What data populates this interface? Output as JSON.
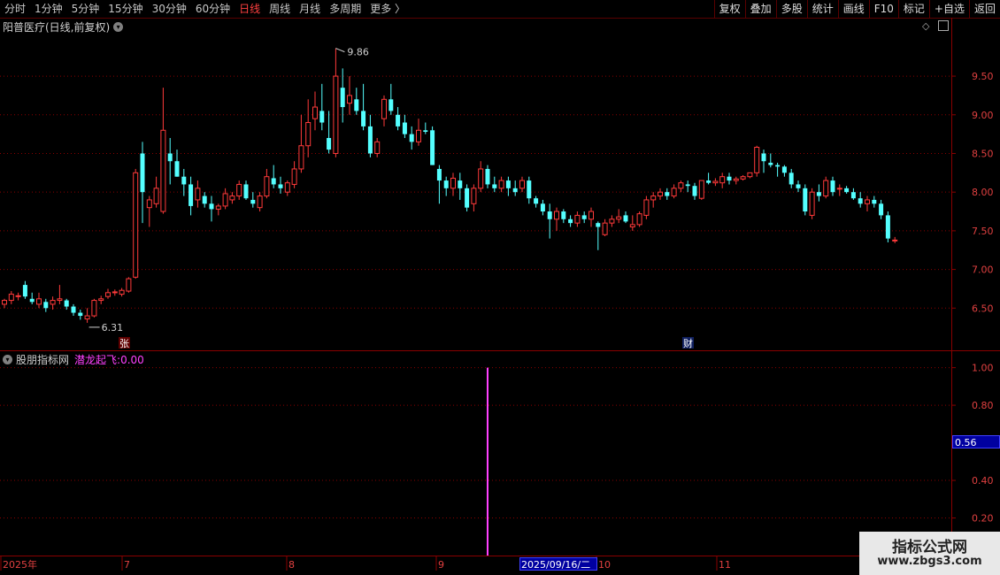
{
  "toolbar": {
    "periods": [
      {
        "label": "分时",
        "active": false
      },
      {
        "label": "1分钟",
        "active": false
      },
      {
        "label": "5分钟",
        "active": false
      },
      {
        "label": "15分钟",
        "active": false
      },
      {
        "label": "30分钟",
        "active": false
      },
      {
        "label": "60分钟",
        "active": false
      },
      {
        "label": "日线",
        "active": true
      },
      {
        "label": "周线",
        "active": false
      },
      {
        "label": "月线",
        "active": false
      },
      {
        "label": "多周期",
        "active": false
      },
      {
        "label": "更多 〉",
        "active": false
      }
    ],
    "actions": [
      "复权",
      "叠加",
      "多股",
      "统计",
      "画线",
      "F10",
      "标记",
      "+自选",
      "返回"
    ]
  },
  "main_panel": {
    "title": "阳普医疗(日线,前复权)",
    "high_marker": "9.86",
    "low_marker": "6.31",
    "badge_zhang": "张",
    "badge_cai": "财"
  },
  "indicator_panel": {
    "title": "股朋指标网",
    "indicator_name": "潜龙起飞",
    "indicator_value": "0.00",
    "cursor_value": "0.56"
  },
  "x_axis": {
    "labels": [
      "2025年",
      "7",
      "8",
      "9",
      "10",
      "11"
    ],
    "cursor_date": "2025/09/16/二"
  },
  "watermark": {
    "line1": "指标公式网",
    "line2": "www.zbgs3.com"
  },
  "colors": {
    "up": "#ff3a3a",
    "down": "#54ffff",
    "grid": "#8a0000",
    "signal": "#ff40ff",
    "background": "#000000"
  },
  "chart_data": [
    {
      "type": "candlestick",
      "price_axis": {
        "ticks": [
          "9.50",
          "9.00",
          "8.50",
          "8.00",
          "7.50",
          "7.00",
          "6.50"
        ],
        "range": [
          6.0,
          10.05
        ]
      },
      "candles": [
        [
          6.55,
          6.62,
          6.5,
          6.6
        ],
        [
          6.6,
          6.72,
          6.55,
          6.68
        ],
        [
          6.65,
          6.7,
          6.6,
          6.66
        ],
        [
          6.8,
          6.85,
          6.62,
          6.65
        ],
        [
          6.62,
          6.7,
          6.55,
          6.58
        ],
        [
          6.55,
          6.7,
          6.5,
          6.62
        ],
        [
          6.58,
          6.62,
          6.45,
          6.5
        ],
        [
          6.55,
          6.65,
          6.48,
          6.6
        ],
        [
          6.6,
          6.8,
          6.55,
          6.62
        ],
        [
          6.6,
          6.62,
          6.48,
          6.52
        ],
        [
          6.52,
          6.55,
          6.4,
          6.44
        ],
        [
          6.44,
          6.48,
          6.35,
          6.4
        ],
        [
          6.36,
          6.5,
          6.31,
          6.4
        ],
        [
          6.4,
          6.62,
          6.38,
          6.6
        ],
        [
          6.6,
          6.66,
          6.55,
          6.62
        ],
        [
          6.65,
          6.75,
          6.62,
          6.7
        ],
        [
          6.7,
          6.74,
          6.66,
          6.71
        ],
        [
          6.68,
          6.76,
          6.65,
          6.73
        ],
        [
          6.72,
          6.9,
          6.7,
          6.88
        ],
        [
          6.9,
          8.3,
          6.88,
          8.25
        ],
        [
          8.5,
          8.65,
          7.6,
          8.0
        ],
        [
          7.8,
          7.95,
          7.55,
          7.9
        ],
        [
          7.85,
          8.2,
          7.8,
          8.05
        ],
        [
          7.75,
          9.35,
          7.72,
          8.8
        ],
        [
          8.5,
          8.7,
          8.1,
          8.4
        ],
        [
          8.4,
          8.55,
          8.2,
          8.2
        ],
        [
          8.2,
          8.3,
          7.95,
          8.1
        ],
        [
          8.1,
          8.2,
          7.7,
          7.82
        ],
        [
          7.9,
          8.15,
          7.8,
          8.05
        ],
        [
          7.95,
          8.0,
          7.8,
          7.85
        ],
        [
          7.85,
          7.95,
          7.62,
          7.78
        ],
        [
          7.78,
          7.85,
          7.7,
          7.82
        ],
        [
          7.82,
          8.05,
          7.78,
          7.98
        ],
        [
          7.9,
          8.0,
          7.85,
          7.95
        ],
        [
          7.95,
          8.15,
          7.9,
          8.1
        ],
        [
          8.1,
          8.15,
          7.9,
          7.92
        ],
        [
          7.9,
          8.0,
          7.8,
          7.85
        ],
        [
          7.8,
          8.0,
          7.75,
          7.95
        ],
        [
          7.95,
          8.3,
          7.92,
          8.2
        ],
        [
          8.18,
          8.35,
          8.05,
          8.1
        ],
        [
          8.1,
          8.2,
          7.98,
          8.05
        ],
        [
          8.0,
          8.15,
          7.95,
          8.12
        ],
        [
          8.1,
          8.4,
          8.05,
          8.3
        ],
        [
          8.3,
          9.0,
          8.25,
          8.6
        ],
        [
          8.6,
          9.2,
          8.45,
          8.9
        ],
        [
          8.95,
          9.3,
          8.8,
          9.1
        ],
        [
          9.05,
          9.4,
          8.8,
          8.9
        ],
        [
          8.7,
          9.05,
          8.5,
          8.55
        ],
        [
          8.5,
          9.86,
          8.45,
          9.5
        ],
        [
          9.35,
          9.6,
          8.9,
          9.1
        ],
        [
          9.15,
          9.5,
          9.0,
          9.25
        ],
        [
          9.2,
          9.35,
          9.0,
          9.05
        ],
        [
          9.05,
          9.4,
          8.8,
          8.85
        ],
        [
          8.85,
          9.0,
          8.45,
          8.5
        ],
        [
          8.5,
          8.7,
          8.45,
          8.65
        ],
        [
          8.95,
          9.25,
          8.85,
          9.2
        ],
        [
          9.2,
          9.4,
          9.0,
          9.05
        ],
        [
          9.0,
          9.1,
          8.8,
          8.85
        ],
        [
          8.9,
          9.0,
          8.7,
          8.75
        ],
        [
          8.75,
          8.85,
          8.55,
          8.65
        ],
        [
          8.65,
          8.95,
          8.6,
          8.8
        ],
        [
          8.8,
          8.9,
          8.75,
          8.78
        ],
        [
          8.8,
          8.85,
          8.35,
          8.35
        ],
        [
          8.3,
          8.35,
          7.85,
          8.15
        ],
        [
          8.15,
          8.2,
          7.95,
          8.05
        ],
        [
          8.05,
          8.25,
          7.95,
          8.18
        ],
        [
          8.15,
          8.25,
          7.9,
          8.05
        ],
        [
          8.05,
          8.1,
          7.75,
          7.8
        ],
        [
          7.85,
          8.1,
          7.75,
          8.05
        ],
        [
          8.05,
          8.4,
          8.0,
          8.3
        ],
        [
          8.3,
          8.35,
          8.05,
          8.1
        ],
        [
          8.1,
          8.2,
          8.0,
          8.05
        ],
        [
          8.05,
          8.2,
          8.0,
          8.15
        ],
        [
          8.15,
          8.2,
          7.95,
          8.05
        ],
        [
          8.05,
          8.15,
          7.95,
          8.0
        ],
        [
          8.05,
          8.2,
          8.0,
          8.15
        ],
        [
          8.15,
          8.2,
          7.85,
          7.92
        ],
        [
          7.92,
          7.95,
          7.8,
          7.85
        ],
        [
          7.85,
          7.9,
          7.7,
          7.75
        ],
        [
          7.75,
          7.85,
          7.4,
          7.65
        ],
        [
          7.65,
          7.8,
          7.5,
          7.75
        ],
        [
          7.75,
          7.78,
          7.6,
          7.65
        ],
        [
          7.65,
          7.7,
          7.55,
          7.6
        ],
        [
          7.6,
          7.75,
          7.55,
          7.7
        ],
        [
          7.7,
          7.75,
          7.6,
          7.65
        ],
        [
          7.65,
          7.8,
          7.55,
          7.75
        ],
        [
          7.6,
          7.62,
          7.25,
          7.55
        ],
        [
          7.45,
          7.65,
          7.43,
          7.6
        ],
        [
          7.6,
          7.7,
          7.55,
          7.65
        ],
        [
          7.65,
          7.78,
          7.6,
          7.68
        ],
        [
          7.7,
          7.75,
          7.6,
          7.62
        ],
        [
          7.55,
          7.7,
          7.5,
          7.58
        ],
        [
          7.58,
          7.75,
          7.55,
          7.72
        ],
        [
          7.7,
          7.95,
          7.65,
          7.9
        ],
        [
          7.9,
          8.0,
          7.8,
          7.95
        ],
        [
          7.95,
          8.05,
          7.9,
          8.0
        ],
        [
          8.0,
          8.05,
          7.9,
          7.95
        ],
        [
          7.95,
          8.1,
          7.92,
          8.05
        ],
        [
          8.05,
          8.15,
          8.0,
          8.12
        ],
        [
          8.1,
          8.15,
          8.0,
          8.08
        ],
        [
          8.08,
          8.12,
          7.9,
          7.95
        ],
        [
          7.92,
          8.15,
          7.9,
          8.15
        ],
        [
          8.15,
          8.25,
          8.1,
          8.12
        ],
        [
          8.12,
          8.18,
          8.08,
          8.14
        ],
        [
          8.12,
          8.25,
          8.05,
          8.2
        ],
        [
          8.2,
          8.25,
          8.1,
          8.15
        ],
        [
          8.15,
          8.2,
          8.1,
          8.17
        ],
        [
          8.17,
          8.22,
          8.15,
          8.2
        ],
        [
          8.2,
          8.25,
          8.18,
          8.25
        ],
        [
          8.25,
          8.6,
          8.2,
          8.58
        ],
        [
          8.5,
          8.55,
          8.25,
          8.4
        ],
        [
          8.38,
          8.5,
          8.32,
          8.35
        ],
        [
          8.35,
          8.38,
          8.2,
          8.33
        ],
        [
          8.33,
          8.35,
          8.2,
          8.25
        ],
        [
          8.25,
          8.3,
          8.05,
          8.1
        ],
        [
          8.1,
          8.15,
          8.0,
          8.05
        ],
        [
          8.05,
          8.1,
          7.7,
          7.75
        ],
        [
          7.7,
          8.05,
          7.65,
          8.0
        ],
        [
          8.0,
          8.1,
          7.88,
          7.95
        ],
        [
          7.95,
          8.2,
          7.92,
          8.15
        ],
        [
          8.15,
          8.2,
          7.95,
          8.0
        ],
        [
          8.05,
          8.1,
          7.95,
          8.05
        ],
        [
          8.05,
          8.08,
          7.98,
          8.0
        ],
        [
          8.0,
          8.05,
          7.9,
          7.92
        ],
        [
          7.92,
          8.0,
          7.8,
          7.85
        ],
        [
          7.85,
          7.95,
          7.75,
          7.9
        ],
        [
          7.9,
          7.95,
          7.8,
          7.85
        ],
        [
          7.85,
          7.9,
          7.65,
          7.7
        ],
        [
          7.7,
          7.75,
          7.35,
          7.4
        ],
        [
          7.38,
          7.42,
          7.34,
          7.38
        ]
      ]
    },
    {
      "type": "bar",
      "series": [
        {
          "name": "潜龙起飞",
          "signal_index": 70,
          "signal_value": 1.0
        }
      ],
      "value_axis": {
        "ticks": [
          "1.00",
          "0.80",
          "0.40",
          "0.20"
        ],
        "range": [
          0.0,
          1.05
        ]
      }
    }
  ]
}
